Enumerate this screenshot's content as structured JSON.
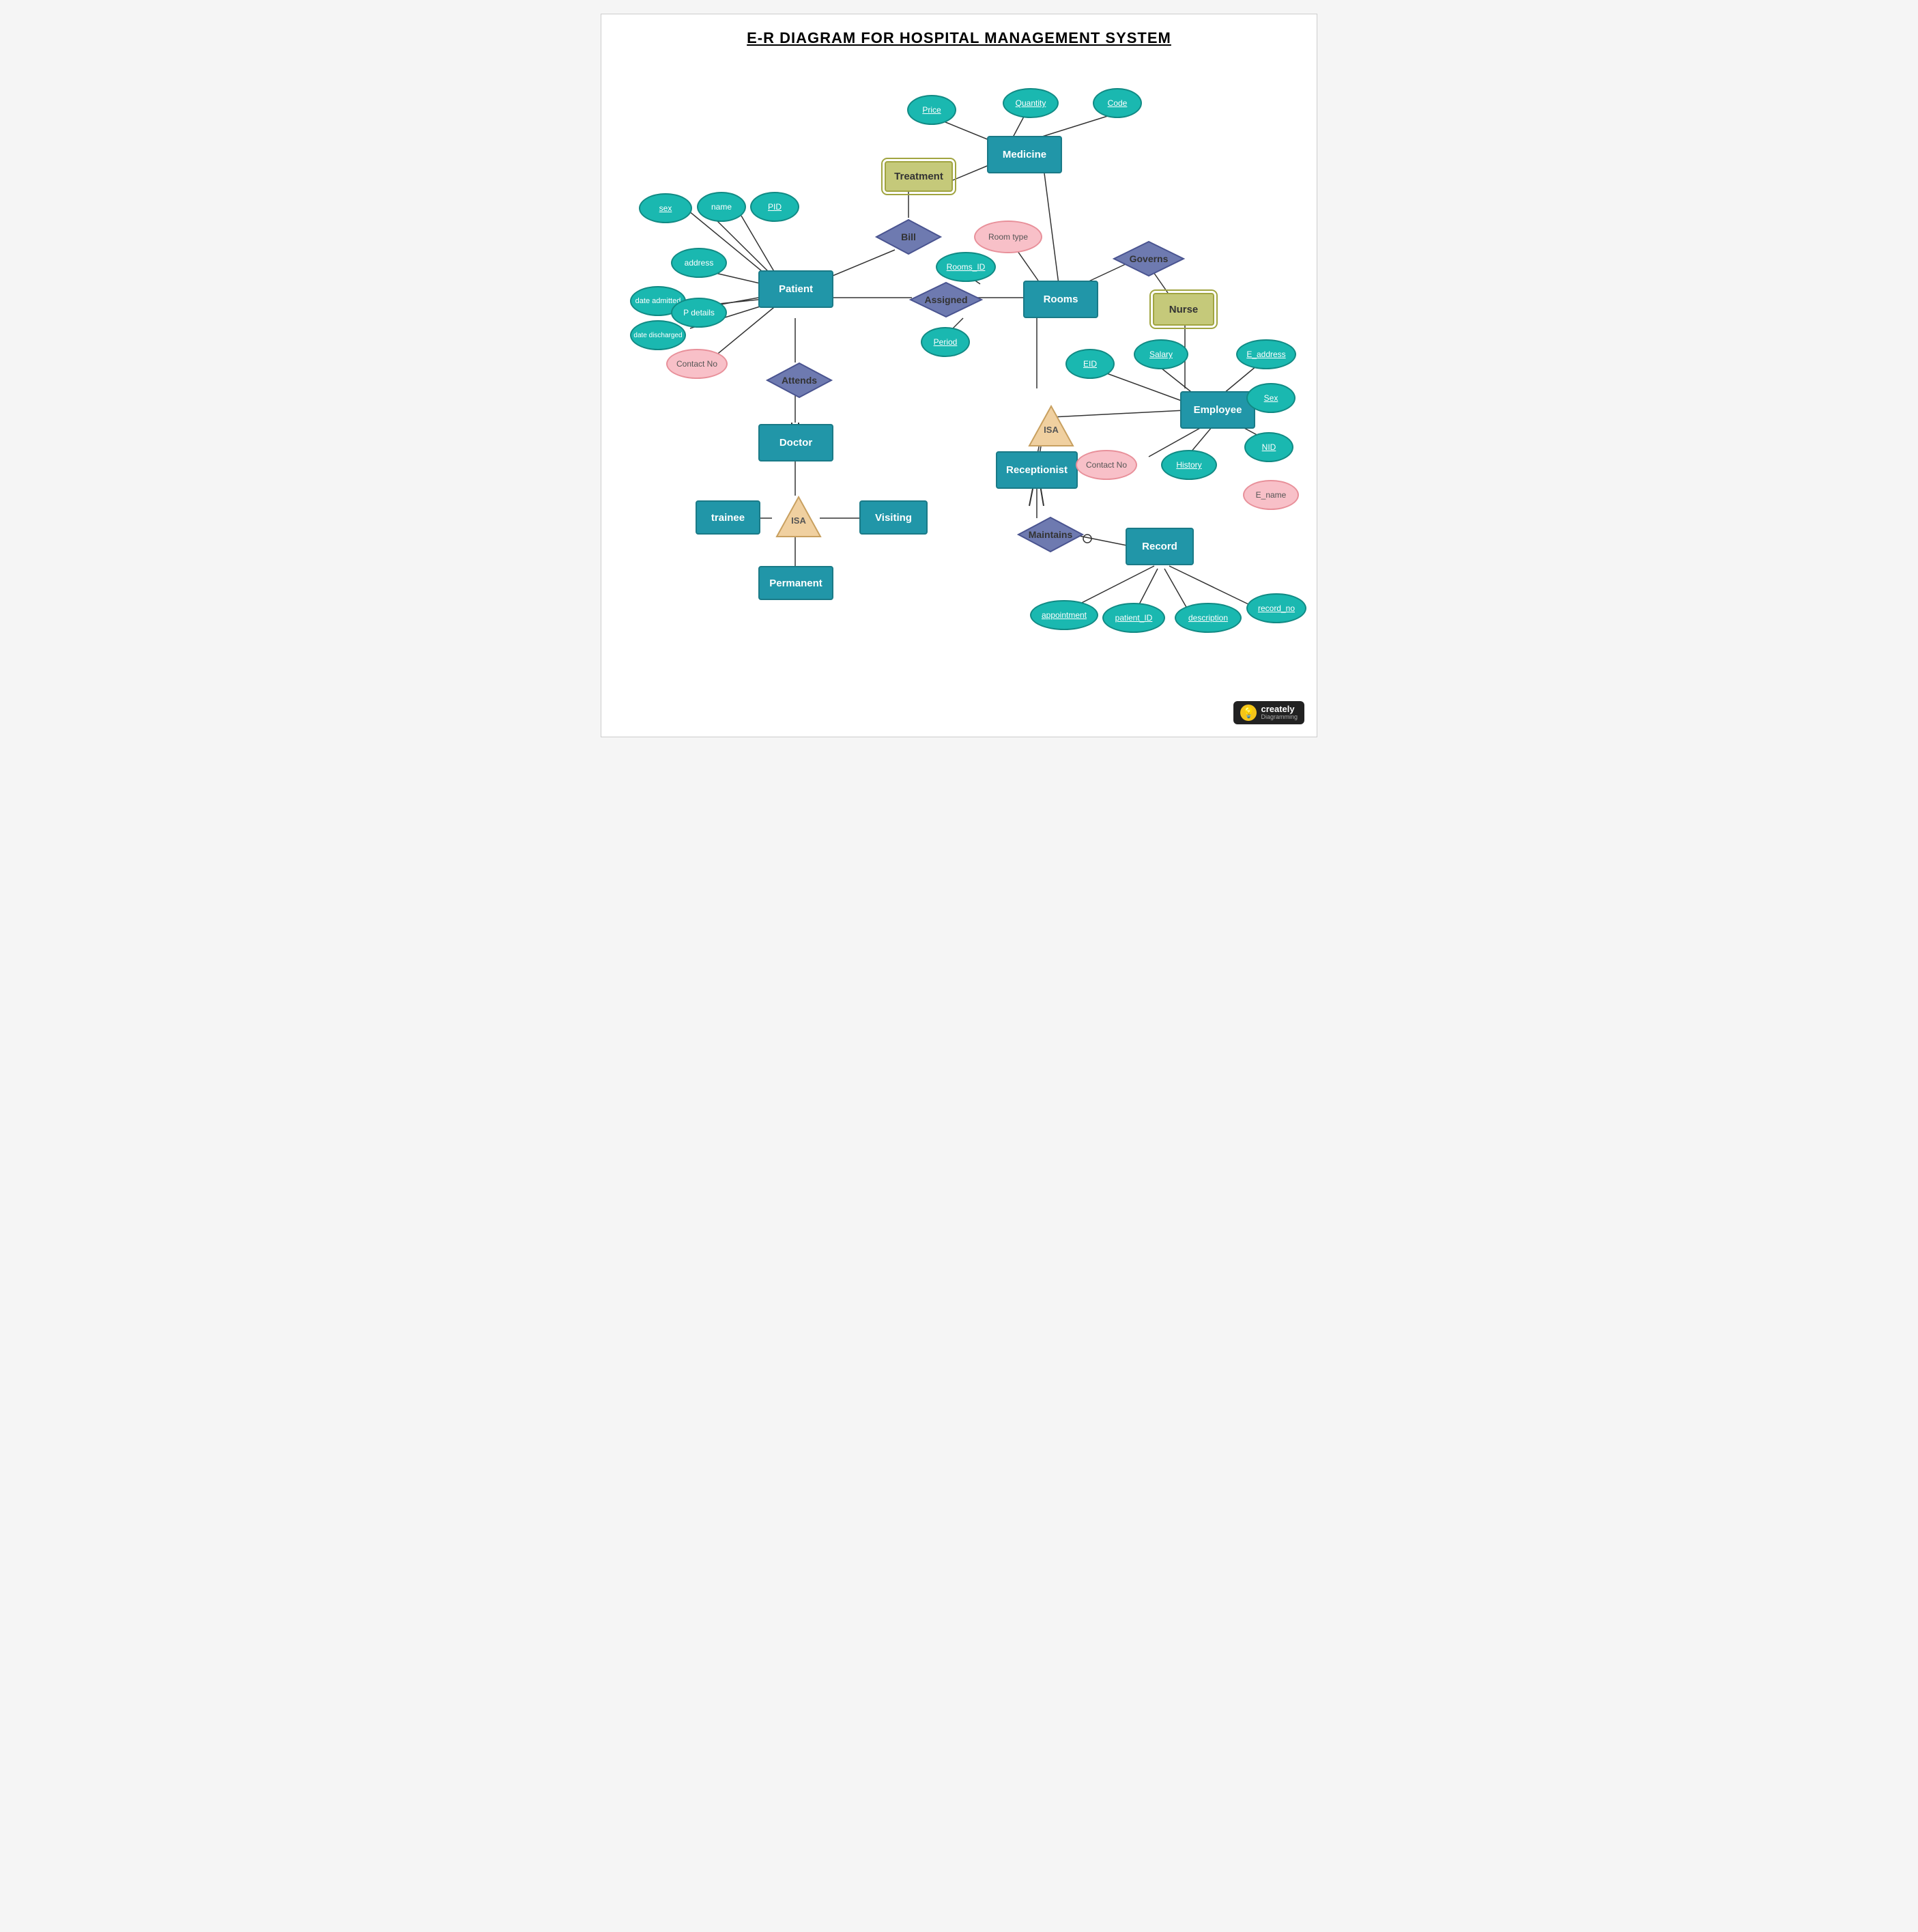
{
  "title": "E-R DIAGRAM FOR HOSPITAL MANAGEMENT SYSTEM",
  "entities": {
    "patient": {
      "label": "Patient"
    },
    "rooms": {
      "label": "Rooms"
    },
    "medicine": {
      "label": "Medicine"
    },
    "nurse": {
      "label": "Nurse"
    },
    "doctor": {
      "label": "Doctor"
    },
    "receptionist": {
      "label": "Receptionist"
    },
    "employee": {
      "label": "Employee"
    },
    "record": {
      "label": "Record"
    },
    "trainee": {
      "label": "trainee"
    },
    "visiting": {
      "label": "Visiting"
    },
    "permanent": {
      "label": "Permanent"
    },
    "treatment": {
      "label": "Treatment"
    },
    "bill": {
      "label": "Bill"
    },
    "assigned": {
      "label": "Assigned"
    },
    "attends": {
      "label": "Attends"
    },
    "governs": {
      "label": "Governs"
    },
    "maintains": {
      "label": "Maintains"
    },
    "isa_doctor": {
      "label": "ISA"
    },
    "isa_employee": {
      "label": "ISA"
    }
  },
  "attributes": {
    "sex": "sex",
    "name": "name",
    "pid": "PID",
    "address": "address",
    "date_admitted": "date admitted",
    "date_discharged": "date discharged",
    "p_details": "P details",
    "rooms_id": "Rooms_ID",
    "period": "Period",
    "price": "Price",
    "quantity": "Quantity",
    "code": "Code",
    "room_type": "Room type",
    "eid": "EID",
    "salary": "Salary",
    "e_address": "E_address",
    "emp_sex": "Sex",
    "nid": "NID",
    "history": "History",
    "e_name": "E_name",
    "contact_no_patient": "Contact No",
    "contact_no_emp": "Contact No",
    "appointment": "appointment",
    "patient_id": "patient_ID",
    "description": "description",
    "record_no": "record_no"
  },
  "creately": {
    "bulb": "💡",
    "brand": "creately",
    "sub": "Diagramming"
  }
}
